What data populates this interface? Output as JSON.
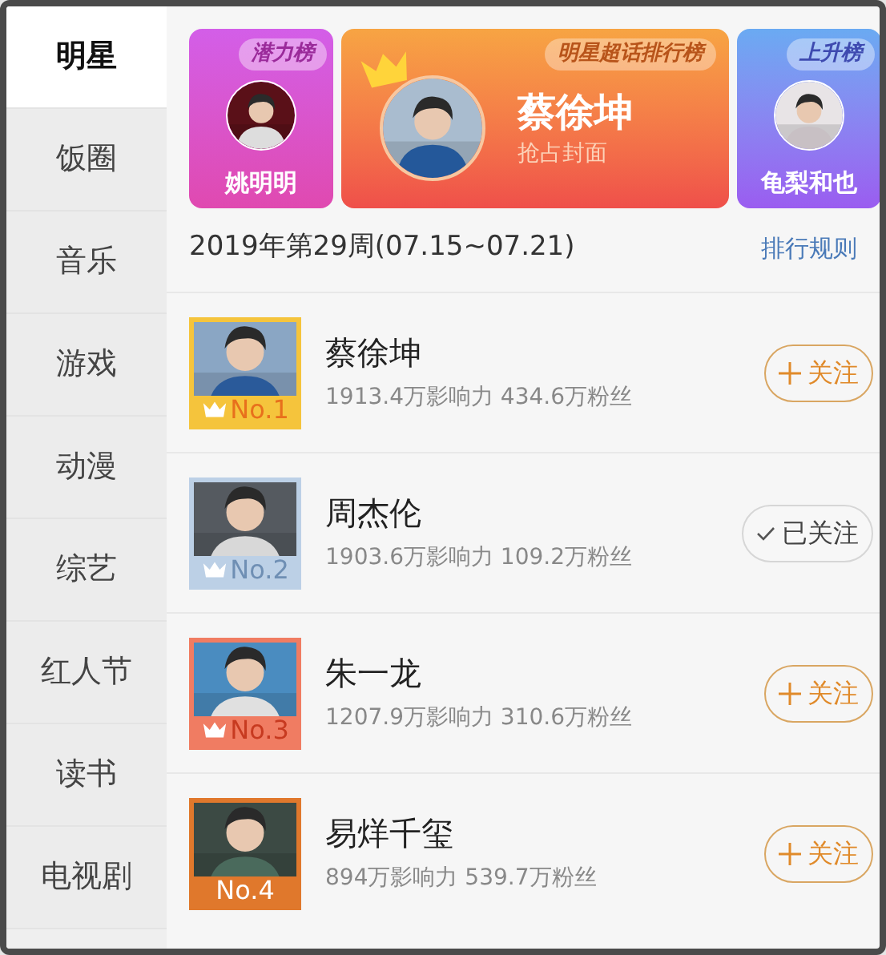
{
  "sidebar": {
    "items": [
      {
        "label": "明星",
        "selected": true
      },
      {
        "label": "饭圈",
        "selected": false
      },
      {
        "label": "音乐",
        "selected": false
      },
      {
        "label": "游戏",
        "selected": false
      },
      {
        "label": "动漫",
        "selected": false
      },
      {
        "label": "综艺",
        "selected": false
      },
      {
        "label": "红人节",
        "selected": false
      },
      {
        "label": "读书",
        "selected": false
      },
      {
        "label": "电视剧",
        "selected": false
      }
    ]
  },
  "banners": [
    {
      "kind": "side",
      "tag": "潜力榜",
      "name": "姚明明"
    },
    {
      "kind": "main",
      "tag": "明星超话排行榜",
      "name": "蔡徐坤",
      "subtitle": "抢占封面"
    },
    {
      "kind": "side",
      "tag": "上升榜",
      "name": "龟梨和也"
    }
  ],
  "week": {
    "title": "2019年第29周(07.15~07.21)",
    "link": "排行规则"
  },
  "ranking": [
    {
      "rank": "No.1",
      "color": "#f5c43c",
      "crown": true,
      "name": "蔡徐坤",
      "stats": "1913.4万影响力 434.6万粉丝",
      "button": "关注",
      "followed": false
    },
    {
      "rank": "No.2",
      "color": "#bcd0e6",
      "crown": true,
      "name": "周杰伦",
      "stats": "1903.6万影响力 109.2万粉丝",
      "button": "已关注",
      "followed": true
    },
    {
      "rank": "No.3",
      "color": "#f07c62",
      "crown": true,
      "name": "朱一龙",
      "stats": "1207.9万影响力 310.6万粉丝",
      "button": "关注",
      "followed": false
    },
    {
      "rank": "No.4",
      "color": "#e0782c",
      "crown": false,
      "name": "易烊千玺",
      "stats": "894万影响力 539.7万粉丝",
      "button": "关注",
      "followed": false
    }
  ]
}
